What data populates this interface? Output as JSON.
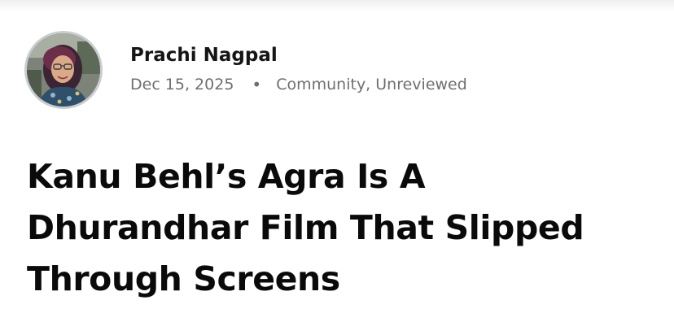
{
  "author": {
    "name": "Prachi Nagpal",
    "date": "Dec 15, 2025",
    "separator": "•",
    "categories": "Community, Unreviewed",
    "avatar_icon": "author-photo"
  },
  "article": {
    "title": "Kanu Behl’s Agra Is A Dhurandhar Film That Slipped Through Screens"
  },
  "colors": {
    "title": "#0a0a0a",
    "author_name": "#161616",
    "meta": "#6f6f6f",
    "avatar_border": "#c9ccd0"
  }
}
